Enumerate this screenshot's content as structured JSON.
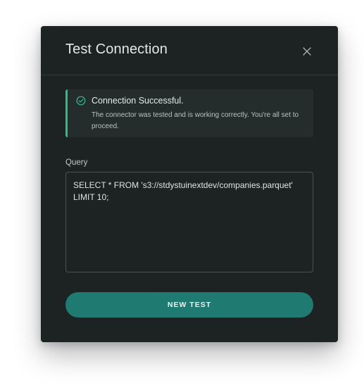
{
  "dialog": {
    "title": "Test Connection",
    "close_icon": "close-icon"
  },
  "alert": {
    "status": "success",
    "icon": "check-circle-icon",
    "title": "Connection Successful.",
    "message": "The connector was tested and is working correctly. You're all set to proceed.",
    "accent_color": "#2fbf86"
  },
  "query": {
    "label": "Query",
    "value": "SELECT * FROM 's3://stdystuinextdev/companies.parquet'\nLIMIT 10;"
  },
  "actions": {
    "new_test_label": "NEW TEST",
    "button_color": "#1f7a72"
  },
  "colors": {
    "dialog_background": "#1c2322",
    "alert_background": "#252d2c"
  }
}
